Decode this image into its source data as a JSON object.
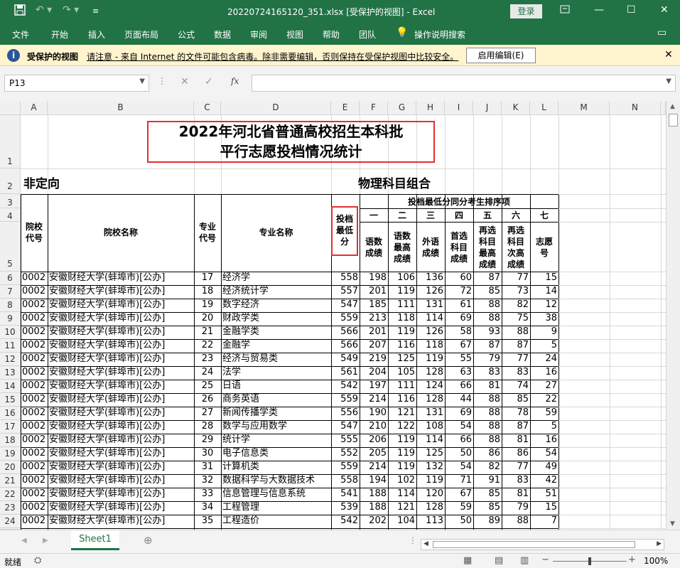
{
  "window": {
    "title": "20220724165120_351.xlsx  [受保护的视图]  -  Excel",
    "login": "登录"
  },
  "ribbon": {
    "tabs": [
      "文件",
      "开始",
      "插入",
      "页面布局",
      "公式",
      "数据",
      "审阅",
      "视图",
      "帮助",
      "团队"
    ],
    "tell_me": "操作说明搜索"
  },
  "protected_bar": {
    "label": "受保护的视图",
    "message": "请注意 - 来自 Internet 的文件可能包含病毒。除非需要编辑，否则保持在受保护视图中比较安全。",
    "enable_button": "启用编辑(E)"
  },
  "formula_bar": {
    "name_box": "P13",
    "fx": "fx",
    "content": ""
  },
  "columns": [
    "A",
    "B",
    "C",
    "D",
    "E",
    "F",
    "G",
    "H",
    "I",
    "J",
    "K",
    "L",
    "M",
    "N"
  ],
  "sheet": {
    "title_line1": "2022年河北省普通高校招生本科批",
    "title_line2": "平行志愿投档情况统计",
    "subtitle_left": "非定向",
    "subtitle_right": "物理科目组合",
    "hdr_school_code": "院校代号",
    "hdr_school_name": "院校名称",
    "hdr_major_code": "专业代号",
    "hdr_major_name": "专业名称",
    "hdr_min_score": "投档最低分",
    "hdr_rank_group": "投档最低分同分考生排序项",
    "hdr_order": [
      "一",
      "二",
      "三",
      "四",
      "五",
      "六",
      "七"
    ],
    "hdr_sub": [
      "语数成绩",
      "语数最高成绩",
      "外语成绩",
      "首选科目成绩",
      "再选科目最高成绩",
      "再选科目次高成绩",
      "志愿号"
    ],
    "rows": [
      {
        "r": "6",
        "a": "0002",
        "b": "安徽财经大学(蚌埠市)[公办]",
        "c": "17",
        "d": "经济学",
        "e": "558",
        "f": "198",
        "g": "106",
        "h": "136",
        "i": "60",
        "j": "87",
        "k": "77",
        "l": "15"
      },
      {
        "r": "7",
        "a": "0002",
        "b": "安徽财经大学(蚌埠市)[公办]",
        "c": "18",
        "d": "经济统计学",
        "e": "557",
        "f": "201",
        "g": "119",
        "h": "126",
        "i": "72",
        "j": "85",
        "k": "73",
        "l": "14"
      },
      {
        "r": "8",
        "a": "0002",
        "b": "安徽财经大学(蚌埠市)[公办]",
        "c": "19",
        "d": "数字经济",
        "e": "547",
        "f": "185",
        "g": "111",
        "h": "131",
        "i": "61",
        "j": "88",
        "k": "82",
        "l": "12"
      },
      {
        "r": "9",
        "a": "0002",
        "b": "安徽财经大学(蚌埠市)[公办]",
        "c": "20",
        "d": "财政学类",
        "e": "559",
        "f": "213",
        "g": "118",
        "h": "114",
        "i": "69",
        "j": "88",
        "k": "75",
        "l": "38"
      },
      {
        "r": "10",
        "a": "0002",
        "b": "安徽财经大学(蚌埠市)[公办]",
        "c": "21",
        "d": "金融学类",
        "e": "566",
        "f": "201",
        "g": "119",
        "h": "126",
        "i": "58",
        "j": "93",
        "k": "88",
        "l": "9"
      },
      {
        "r": "11",
        "a": "0002",
        "b": "安徽财经大学(蚌埠市)[公办]",
        "c": "22",
        "d": "金融学",
        "e": "566",
        "f": "207",
        "g": "116",
        "h": "118",
        "i": "67",
        "j": "87",
        "k": "87",
        "l": "5"
      },
      {
        "r": "12",
        "a": "0002",
        "b": "安徽财经大学(蚌埠市)[公办]",
        "c": "23",
        "d": "经济与贸易类",
        "e": "549",
        "f": "219",
        "g": "125",
        "h": "119",
        "i": "55",
        "j": "79",
        "k": "77",
        "l": "24"
      },
      {
        "r": "13",
        "a": "0002",
        "b": "安徽财经大学(蚌埠市)[公办]",
        "c": "24",
        "d": "法学",
        "e": "561",
        "f": "204",
        "g": "105",
        "h": "128",
        "i": "63",
        "j": "83",
        "k": "83",
        "l": "16"
      },
      {
        "r": "14",
        "a": "0002",
        "b": "安徽财经大学(蚌埠市)[公办]",
        "c": "25",
        "d": "日语",
        "e": "542",
        "f": "197",
        "g": "111",
        "h": "124",
        "i": "66",
        "j": "81",
        "k": "74",
        "l": "27"
      },
      {
        "r": "15",
        "a": "0002",
        "b": "安徽财经大学(蚌埠市)[公办]",
        "c": "26",
        "d": "商务英语",
        "e": "559",
        "f": "214",
        "g": "116",
        "h": "128",
        "i": "44",
        "j": "88",
        "k": "85",
        "l": "22"
      },
      {
        "r": "16",
        "a": "0002",
        "b": "安徽财经大学(蚌埠市)[公办]",
        "c": "27",
        "d": "新闻传播学类",
        "e": "556",
        "f": "190",
        "g": "121",
        "h": "131",
        "i": "69",
        "j": "88",
        "k": "78",
        "l": "59"
      },
      {
        "r": "17",
        "a": "0002",
        "b": "安徽财经大学(蚌埠市)[公办]",
        "c": "28",
        "d": "数学与应用数学",
        "e": "547",
        "f": "210",
        "g": "122",
        "h": "108",
        "i": "54",
        "j": "88",
        "k": "87",
        "l": "5"
      },
      {
        "r": "18",
        "a": "0002",
        "b": "安徽财经大学(蚌埠市)[公办]",
        "c": "29",
        "d": "统计学",
        "e": "555",
        "f": "206",
        "g": "119",
        "h": "114",
        "i": "66",
        "j": "88",
        "k": "81",
        "l": "16"
      },
      {
        "r": "19",
        "a": "0002",
        "b": "安徽财经大学(蚌埠市)[公办]",
        "c": "30",
        "d": "电子信息类",
        "e": "552",
        "f": "205",
        "g": "119",
        "h": "125",
        "i": "50",
        "j": "86",
        "k": "86",
        "l": "54"
      },
      {
        "r": "20",
        "a": "0002",
        "b": "安徽财经大学(蚌埠市)[公办]",
        "c": "31",
        "d": "计算机类",
        "e": "559",
        "f": "214",
        "g": "119",
        "h": "132",
        "i": "54",
        "j": "82",
        "k": "77",
        "l": "49"
      },
      {
        "r": "21",
        "a": "0002",
        "b": "安徽财经大学(蚌埠市)[公办]",
        "c": "32",
        "d": "数据科学与大数据技术",
        "e": "558",
        "f": "194",
        "g": "102",
        "h": "119",
        "i": "71",
        "j": "91",
        "k": "83",
        "l": "42"
      },
      {
        "r": "22",
        "a": "0002",
        "b": "安徽财经大学(蚌埠市)[公办]",
        "c": "33",
        "d": "信息管理与信息系统",
        "e": "541",
        "f": "188",
        "g": "114",
        "h": "120",
        "i": "67",
        "j": "85",
        "k": "81",
        "l": "51"
      },
      {
        "r": "23",
        "a": "0002",
        "b": "安徽财经大学(蚌埠市)[公办]",
        "c": "34",
        "d": "工程管理",
        "e": "539",
        "f": "188",
        "g": "121",
        "h": "128",
        "i": "59",
        "j": "85",
        "k": "79",
        "l": "15"
      },
      {
        "r": "24",
        "a": "0002",
        "b": "安徽财经大学(蚌埠市)[公办]",
        "c": "35",
        "d": "工程造价",
        "e": "542",
        "f": "202",
        "g": "104",
        "h": "113",
        "i": "50",
        "j": "89",
        "k": "88",
        "l": "7"
      }
    ]
  },
  "tabs": {
    "sheet1": "Sheet1"
  },
  "status": {
    "ready": "就绪",
    "zoom": "100%"
  },
  "colors": {
    "excel_green": "#217346",
    "highlight_red": "#e03030"
  }
}
